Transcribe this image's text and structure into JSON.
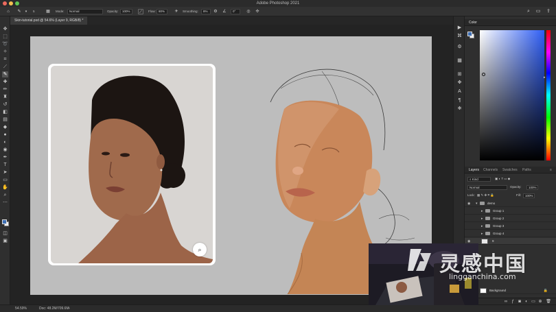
{
  "app": {
    "title": "Adobe Photoshop 2021"
  },
  "colors": {
    "accent": "#3e6fb5",
    "canvas_gray": "#bdbdbd",
    "ui_dark": "#2f2f2f"
  },
  "options_bar": {
    "mode_label": "Mode:",
    "mode_value": "Normal",
    "opacity_label": "Opacity:",
    "opacity_value": "100%",
    "flow_label": "Flow:",
    "flow_value": "80%",
    "smoothing_label": "Smoothing:",
    "smoothing_value": "8%",
    "angle_value": "0°",
    "brush_size": "5"
  },
  "document": {
    "tab_title": "Skin-tutorial.psd @ 54.6% (Layer 9, RGB/8) *"
  },
  "status": {
    "zoom": "54.59%",
    "doc_info": "Doc: 48.2M/709.6M"
  },
  "toolbox": {
    "tools": [
      "move-icon",
      "marquee-icon",
      "lasso-icon",
      "quick-select-icon",
      "crop-icon",
      "eyedropper-icon",
      "brush-icon",
      "healing-icon",
      "clone-stamp-icon",
      "history-brush-icon",
      "eraser-icon",
      "gradient-icon",
      "blur-icon",
      "dodge-icon",
      "pen-icon",
      "type-icon",
      "path-select-icon",
      "rectangle-icon",
      "hand-icon",
      "zoom-icon"
    ]
  },
  "color_panel": {
    "tab": "Color"
  },
  "layers_panel": {
    "tabs": [
      "Layers",
      "Channels",
      "Swatches",
      "Paths"
    ],
    "kind_filter": "Kind",
    "blend_mode": "Normal",
    "opacity_label": "Opacity:",
    "opacity_value": "100%",
    "lock_label": "Lock:",
    "fill_label": "Fill:",
    "fill_value": "100%",
    "layers": [
      {
        "name": "demo",
        "type": "group",
        "indent": 0,
        "visible": true
      },
      {
        "name": "Group 1",
        "type": "group",
        "indent": 1,
        "visible": false
      },
      {
        "name": "Group 2",
        "type": "group",
        "indent": 1,
        "visible": false
      },
      {
        "name": "Group 3",
        "type": "group",
        "indent": 1,
        "visible": false
      },
      {
        "name": "Group 4",
        "type": "group",
        "indent": 1,
        "visible": false
      },
      {
        "name": "9",
        "type": "layer",
        "indent": 1,
        "visible": true
      },
      {
        "name": "Background",
        "type": "background",
        "indent": 0,
        "visible": false
      }
    ]
  },
  "watermark": {
    "cn": "灵感中国",
    "url": "lingganchina.com"
  }
}
